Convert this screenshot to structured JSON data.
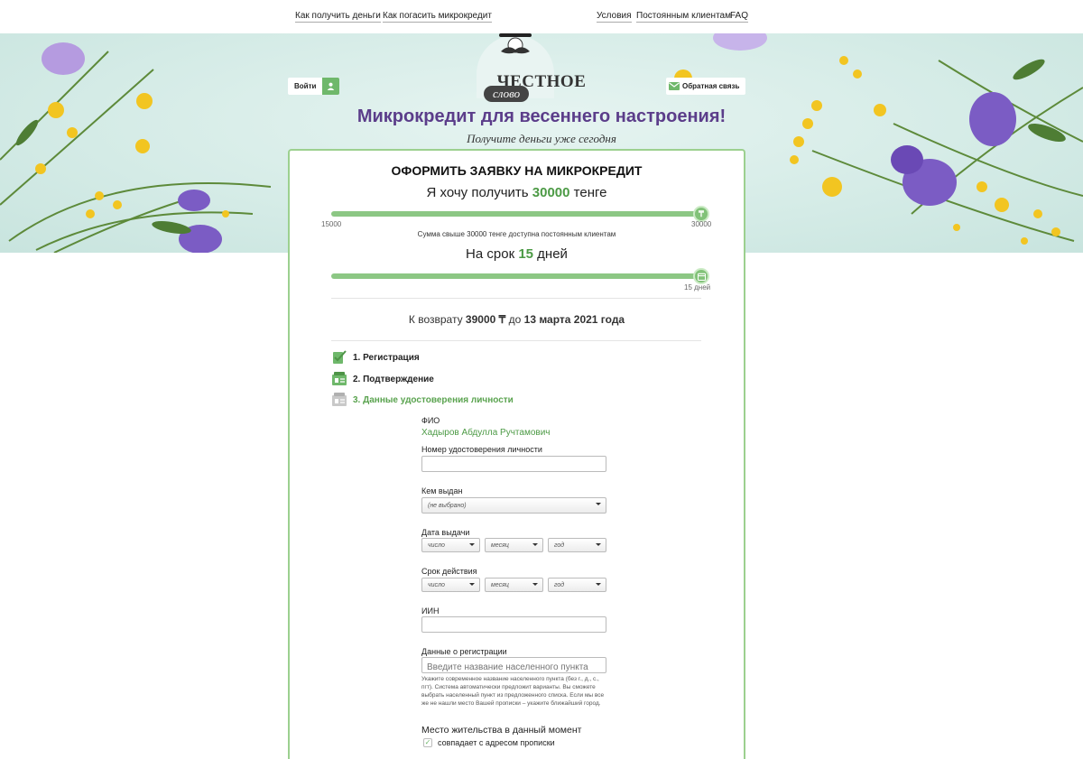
{
  "nav": {
    "left": [
      "Как получить деньги",
      "Как погасить микрокредит"
    ],
    "right": [
      "Условия",
      "Постоянным клиентам",
      "FAQ"
    ]
  },
  "header": {
    "login_label": "Войти",
    "feedback_label": "Обратная связь",
    "logo_top": "ЧЕСТНОЕ",
    "logo_bottom": "слово",
    "title": "Микрокредит для весеннего настроения!",
    "subtitle": "Получите деньги уже сегодня"
  },
  "form": {
    "title": "ОФОРМИТЬ ЗАЯВКУ НА МИКРОКРЕДИТ",
    "amount_prefix": "Я хочу получить",
    "amount_value": "30000",
    "amount_suffix": "тенге",
    "amount_min_label": "15000",
    "amount_max_label": "30000",
    "amount_fraction": 1.0,
    "amount_hint": "Сумма свыше 30000 тенге доступна постоянным клиентам",
    "term_prefix": "На срок",
    "term_value": "15",
    "term_suffix": "дней",
    "term_max_label": "15 дней",
    "term_fraction": 1.0,
    "return_prefix": "К возврату",
    "return_amount": "39000 ₸",
    "return_mid": "до",
    "return_date": "13 марта 2021 года",
    "steps": [
      {
        "label": "1. Регистрация"
      },
      {
        "label": "2. Подтверждение"
      },
      {
        "label": "3. Данные удостоверения личности"
      }
    ],
    "fio_label": "ФИО",
    "fio_value": "Хадыров Абдулла Ручтамович",
    "id_number_label": "Номер удостоверения личности",
    "id_number_value": "",
    "issued_by_label": "Кем выдан",
    "issued_by_value": "(не выбрано)",
    "issue_date_label": "Дата выдачи",
    "validity_label": "Срок действия",
    "day_placeholder": "число",
    "month_placeholder": "месяц",
    "year_placeholder": "год",
    "iin_label": "ИИН",
    "iin_value": "",
    "registration_label": "Данные о регистрации",
    "registration_placeholder": "Введите название населенного пункта",
    "registration_note": "Укажите современное название населенного пункта (без г., д., с., пгт). Система автоматически предложит варианты. Вы сможете выбрать населенный пункт из предложенного списка. Если мы все же не нашли место Вашей прописки – укажите ближайший город.",
    "residence_label": "Место жительства в данный момент",
    "same_address_label": "совпадает с адресом прописки",
    "same_address_checked": true
  },
  "colors": {
    "accent_green": "#4c9a45",
    "slider_green": "#8cc784",
    "title_purple": "#5b3d8a",
    "hero_bg": "#d7ece8"
  }
}
